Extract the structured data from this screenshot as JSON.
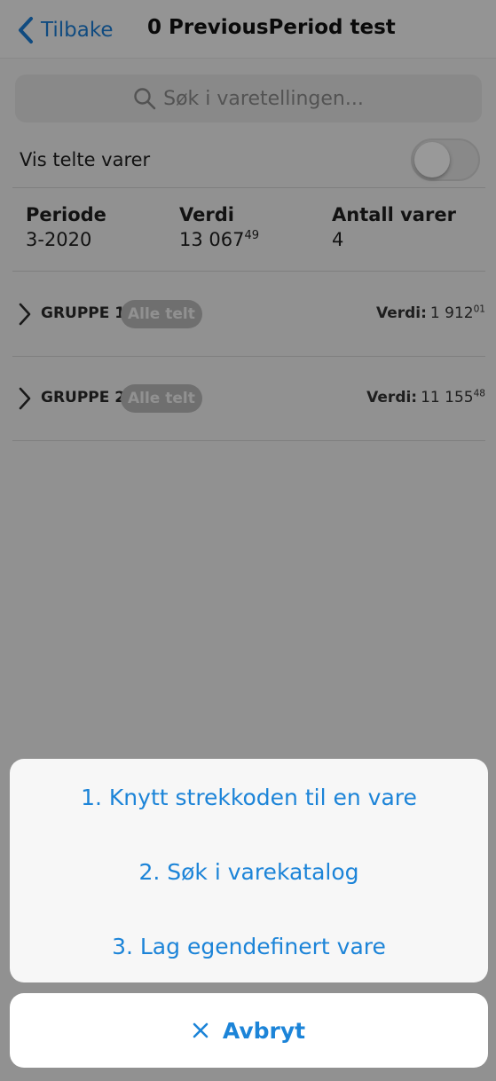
{
  "header": {
    "back_label": "Tilbake",
    "title": "0 PreviousPeriod test"
  },
  "search": {
    "placeholder": "Søk i varetellingen..."
  },
  "filter": {
    "show_counted_label": "Vis telte varer",
    "show_counted_on": false
  },
  "summary": {
    "period_label": "Periode",
    "period_value": "3-2020",
    "value_label": "Verdi",
    "value_main": "13 067",
    "value_decimals": "49",
    "count_label": "Antall varer",
    "count_value": "4"
  },
  "groups": [
    {
      "name": "GRUPPE 1",
      "badge": "Alle telt",
      "value_label": "Verdi:",
      "value_main": "1 912",
      "value_decimals": "01"
    },
    {
      "name": "GRUPPE 2",
      "badge": "Alle telt",
      "value_label": "Verdi:",
      "value_main": "11 155",
      "value_decimals": "48"
    }
  ],
  "action_sheet": {
    "options": [
      "1. Knytt strekkoden til en vare",
      "2. Søk i varekatalog",
      "3. Lag egendefinert vare"
    ],
    "cancel_label": "Avbryt",
    "cancel_icon": "close-icon"
  },
  "colors": {
    "accent": "#1c84d8",
    "overlay": "rgba(0,0,0,0.4)"
  }
}
